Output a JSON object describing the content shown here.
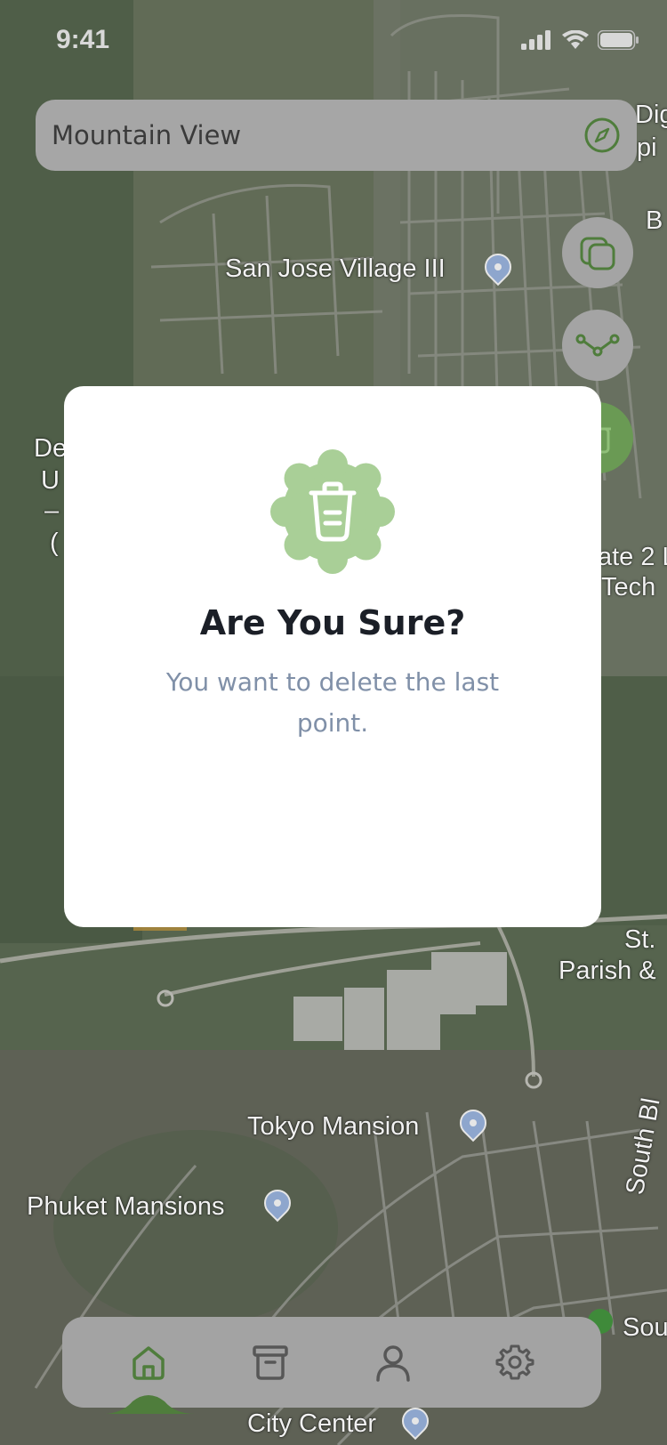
{
  "status_bar": {
    "time": "9:41",
    "icons": [
      "signal-icon",
      "wifi-icon",
      "battery-icon"
    ]
  },
  "search": {
    "value": "Mountain View",
    "icon": "compass-icon"
  },
  "map": {
    "labels": {
      "san_jose": "San Jose Village III",
      "tokyo": "Tokyo Mansion",
      "phuket": "Phuket Mansions",
      "city_center": "City Center",
      "st_parish_1": "St.",
      "st_parish_2": "Parish &",
      "tech_1": "ate 2 L",
      "tech_2": "Tech",
      "dig_1": "Dig",
      "dig_2": "pi",
      "b": "B",
      "de_1": "De",
      "de_2": "U",
      "de_3": "–",
      "de_4": "(",
      "south": "South Bl",
      "sou": "Sou"
    }
  },
  "fab": [
    "layers-icon",
    "route-icon",
    "trash-icon"
  ],
  "modal": {
    "title": "Are You Sure?",
    "message": "You want to delete the last point.",
    "icon": "trash-icon"
  },
  "nav": {
    "items": [
      "home-icon",
      "archive-icon",
      "profile-icon",
      "settings-icon"
    ],
    "active": "home"
  },
  "colors": {
    "accent": "#6a9a54",
    "badge": "#a9cf97",
    "title": "#1b1f27",
    "message": "#8090a8"
  }
}
